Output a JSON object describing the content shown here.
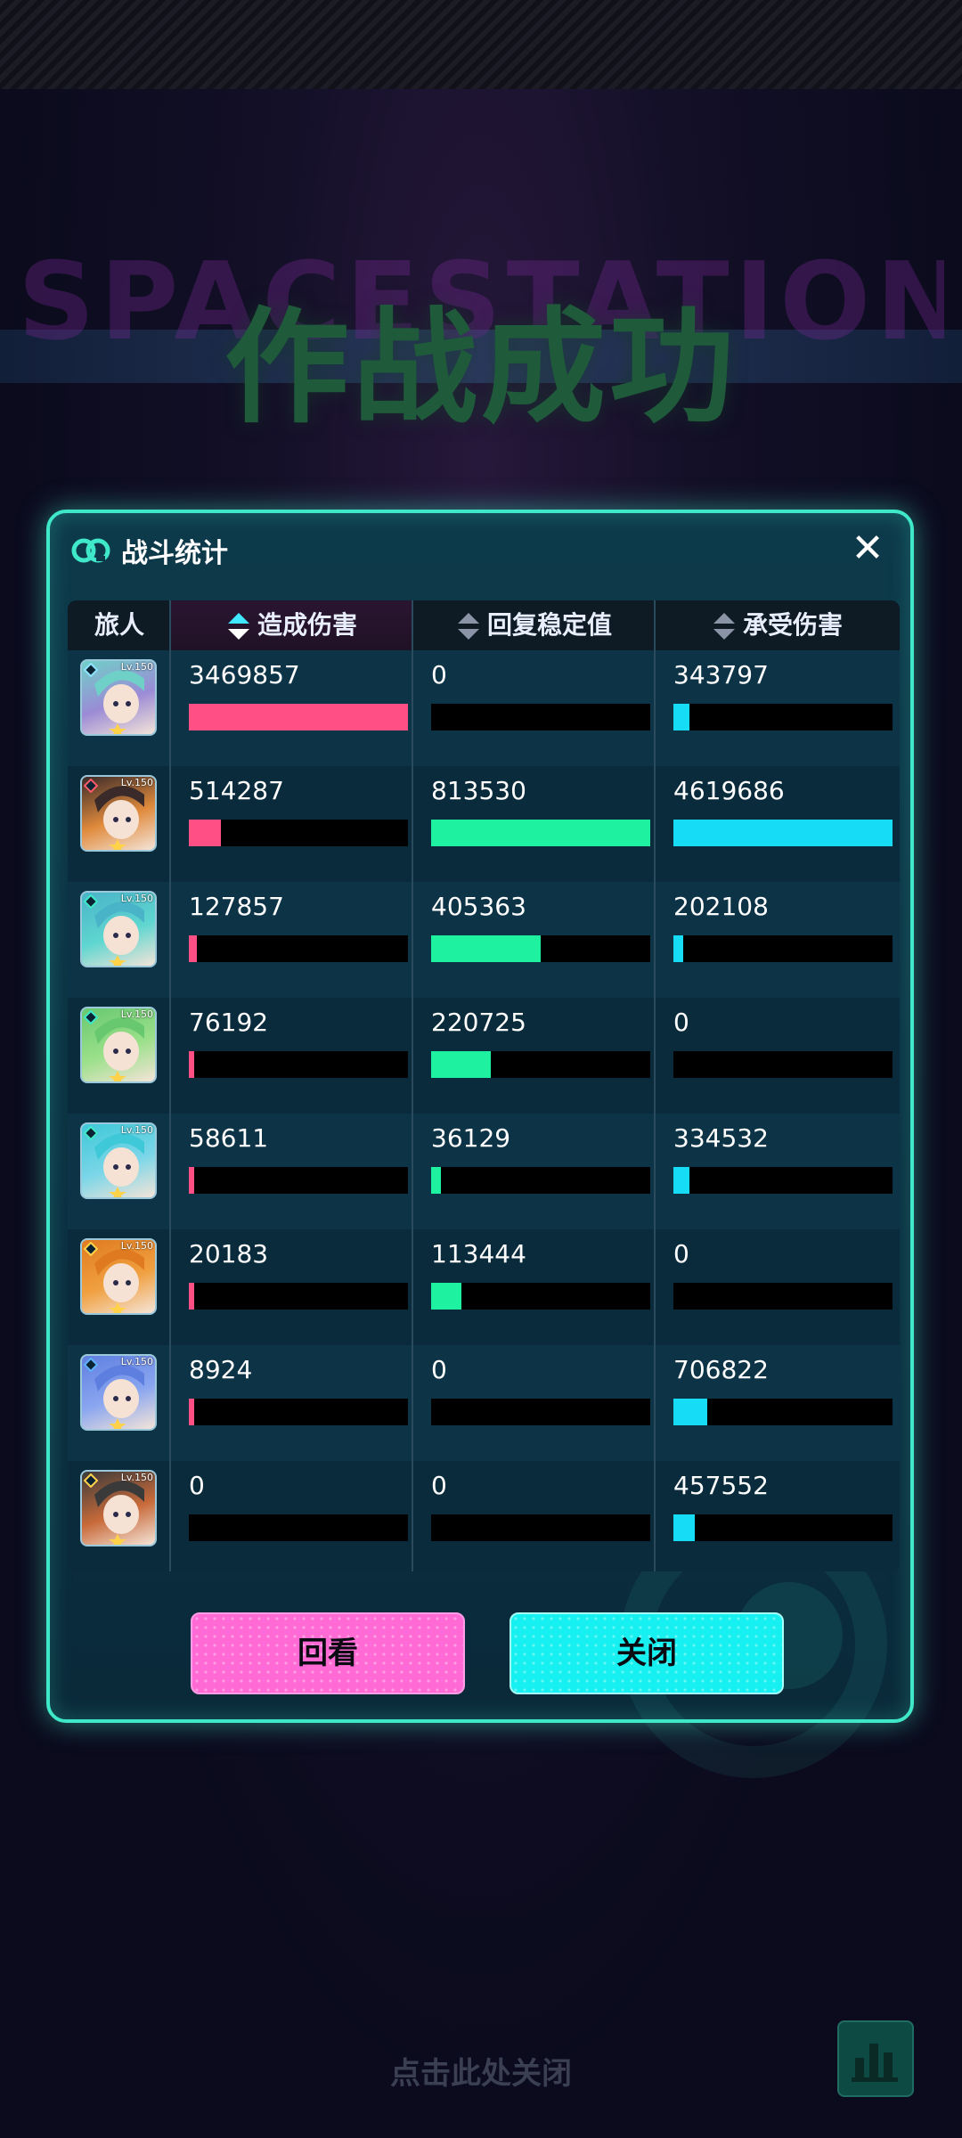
{
  "background": {
    "banner_title": "作战成功",
    "glitch_text": "SPACESTATION",
    "footer_hint": "点击此处关闭",
    "stats_icon": "bar-chart-icon"
  },
  "panel": {
    "title": "战斗统计",
    "logo_icon": "ring-logo-icon",
    "close_icon": "close-icon",
    "close_glyph": "✕"
  },
  "table": {
    "headers": {
      "traveler": "旅人",
      "damage_dealt": "造成伤害",
      "recovery": "回复稳定值",
      "damage_taken": "承受伤害"
    },
    "sorted_column": "damage_dealt",
    "max": {
      "damage_dealt": 3469857,
      "recovery": 813530,
      "damage_taken": 4619686
    },
    "rows": [
      {
        "level": "Lv.150",
        "damage_dealt": "3469857",
        "recovery": "0",
        "damage_taken": "343797",
        "dd": 3469857,
        "rc": 0,
        "dt": 343797,
        "portrait": "#9b8bd6",
        "hair": "#6fd0c8",
        "badge": "#8fe3ff"
      },
      {
        "level": "Lv.150",
        "damage_dealt": "514287",
        "recovery": "813530",
        "damage_taken": "4619686",
        "dd": 514287,
        "rc": 813530,
        "dt": 4619686,
        "portrait": "#e08a3c",
        "hair": "#3a2a2a",
        "badge": "#ff5a6a"
      },
      {
        "level": "Lv.150",
        "damage_dealt": "127857",
        "recovery": "405363",
        "damage_taken": "202108",
        "dd": 127857,
        "rc": 405363,
        "dt": 202108,
        "portrait": "#5fd6d0",
        "hair": "#49b3c8",
        "badge": "#3fe8c8"
      },
      {
        "level": "Lv.150",
        "damage_dealt": "76192",
        "recovery": "220725",
        "damage_taken": "0",
        "dd": 76192,
        "rc": 220725,
        "dt": 0,
        "portrait": "#9be08a",
        "hair": "#67c870",
        "badge": "#3fe8c8"
      },
      {
        "level": "Lv.150",
        "damage_dealt": "58611",
        "recovery": "36129",
        "damage_taken": "334532",
        "dd": 58611,
        "rc": 36129,
        "dt": 334532,
        "portrait": "#7ad6e8",
        "hair": "#3ec8d8",
        "badge": "#3fe8c8"
      },
      {
        "level": "Lv.150",
        "damage_dealt": "20183",
        "recovery": "113444",
        "damage_taken": "0",
        "dd": 20183,
        "rc": 113444,
        "dt": 0,
        "portrait": "#f0a040",
        "hair": "#e07a20",
        "badge": "#ffd24a"
      },
      {
        "level": "Lv.150",
        "damage_dealt": "8924",
        "recovery": "0",
        "damage_taken": "706822",
        "dd": 8924,
        "rc": 0,
        "dt": 706822,
        "portrait": "#8aa6f0",
        "hair": "#5f7fe0",
        "badge": "#5fb0ff"
      },
      {
        "level": "Lv.150",
        "damage_dealt": "0",
        "recovery": "0",
        "damage_taken": "457552",
        "dd": 0,
        "rc": 0,
        "dt": 457552,
        "portrait": "#c86a3a",
        "hair": "#3a3a3a",
        "badge": "#ffd24a"
      }
    ],
    "colors": {
      "damage_dealt": "#ff4f84",
      "recovery": "#1ef2a0",
      "damage_taken": "#16dcf5"
    }
  },
  "buttons": {
    "replay": "回看",
    "close": "关闭"
  }
}
